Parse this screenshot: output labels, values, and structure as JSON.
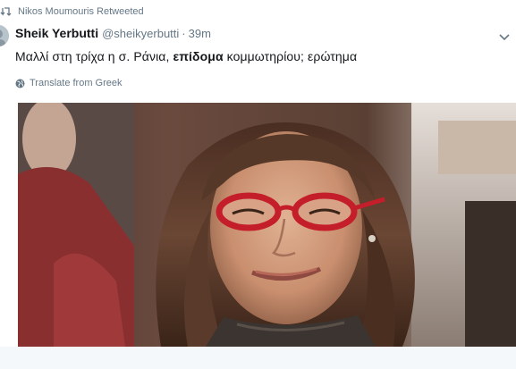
{
  "retweet": {
    "label": "Nikos Moumouris Retweeted",
    "icon": "retweet-icon"
  },
  "author": {
    "display_name": "Sheik Yerbutti",
    "handle": "@sheikyerbutti",
    "separator": "·",
    "time": "39m"
  },
  "tweet": {
    "text_before": "Μαλλί στη τρίχα η σ. Ράνια, ",
    "text_bold": "επίδομα",
    "text_after": " κομμωτηρίου; ερώτημα"
  },
  "translate": {
    "label": "Translate from Greek",
    "icon": "globe-icon"
  },
  "menu": {
    "icon": "chevron-down-icon"
  },
  "media": {
    "icon": "photo"
  },
  "colors": {
    "text_primary": "#14171a",
    "text_secondary": "#657786",
    "glasses_red": "#c41e2a"
  }
}
